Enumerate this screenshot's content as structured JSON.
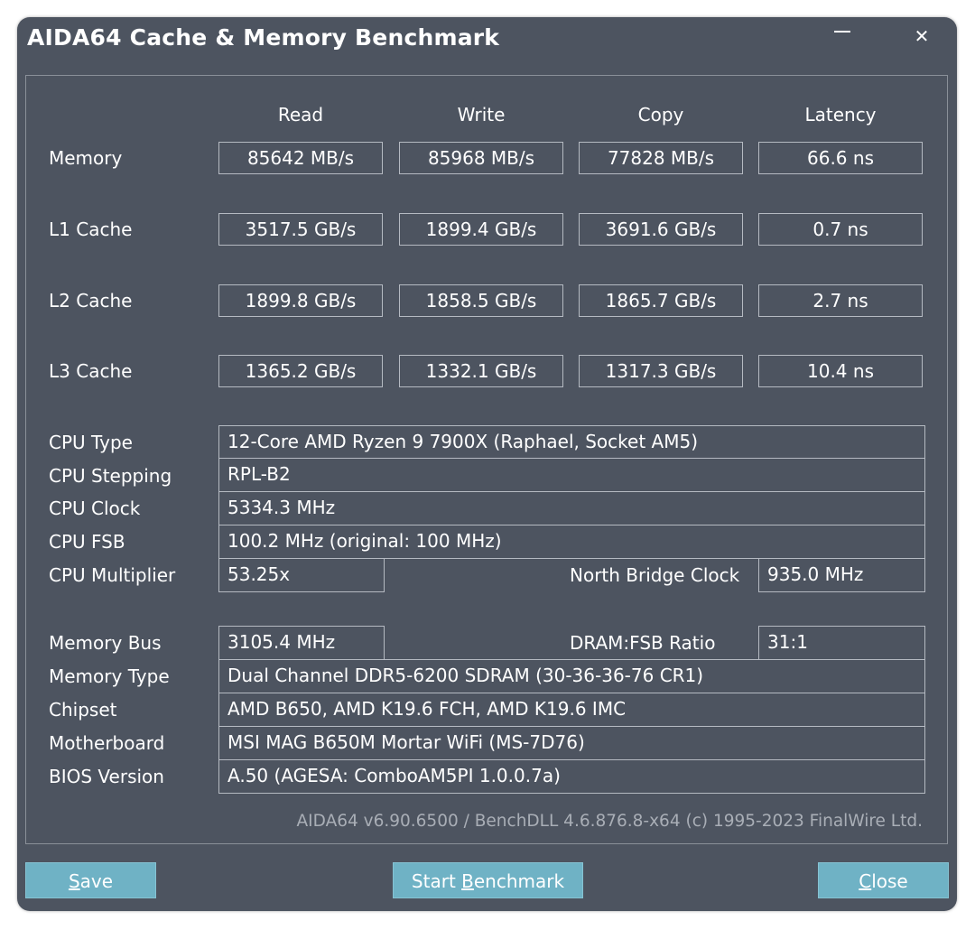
{
  "window": {
    "title": "AIDA64 Cache & Memory Benchmark",
    "close_glyph": "✕"
  },
  "columns": [
    "Read",
    "Write",
    "Copy",
    "Latency"
  ],
  "rows": [
    {
      "label": "Memory",
      "values": [
        "85642 MB/s",
        "85968 MB/s",
        "77828 MB/s",
        "66.6 ns"
      ]
    },
    {
      "label": "L1 Cache",
      "values": [
        "3517.5 GB/s",
        "1899.4 GB/s",
        "3691.6 GB/s",
        "0.7 ns"
      ]
    },
    {
      "label": "L2 Cache",
      "values": [
        "1899.8 GB/s",
        "1858.5 GB/s",
        "1865.7 GB/s",
        "2.7 ns"
      ]
    },
    {
      "label": "L3 Cache",
      "values": [
        "1365.2 GB/s",
        "1332.1 GB/s",
        "1317.3 GB/s",
        "10.4 ns"
      ]
    }
  ],
  "cpu": {
    "type_label": "CPU Type",
    "type_value": "12-Core AMD Ryzen 9 7900X  (Raphael, Socket AM5)",
    "stepping_label": "CPU Stepping",
    "stepping_value": "RPL-B2",
    "clock_label": "CPU Clock",
    "clock_value": "5334.3 MHz",
    "fsb_label": "CPU FSB",
    "fsb_value": "100.2 MHz  (original: 100 MHz)",
    "multiplier_label": "CPU Multiplier",
    "multiplier_value": "53.25x",
    "nb_clock_label": "North Bridge Clock",
    "nb_clock_value": "935.0 MHz"
  },
  "memory": {
    "bus_label": "Memory Bus",
    "bus_value": "3105.4 MHz",
    "ratio_label": "DRAM:FSB Ratio",
    "ratio_value": "31:1",
    "type_label": "Memory Type",
    "type_value": "Dual Channel DDR5-6200 SDRAM  (30-36-36-76 CR1)",
    "chipset_label": "Chipset",
    "chipset_value": "AMD B650, AMD K19.6 FCH, AMD K19.6 IMC",
    "motherboard_label": "Motherboard",
    "motherboard_value": "MSI MAG B650M Mortar WiFi (MS-7D76)",
    "bios_label": "BIOS Version",
    "bios_value": "A.50  (AGESA: ComboAM5PI 1.0.0.7a)"
  },
  "footer": "AIDA64 v6.90.6500 / BenchDLL 4.6.876.8-x64  (c) 1995-2023 FinalWire Ltd.",
  "buttons": {
    "save_first": "S",
    "save_rest": "ave",
    "start_pre": "Start ",
    "start_u": "B",
    "start_rest": "enchmark",
    "close_first": "C",
    "close_rest": "lose"
  },
  "colors": {
    "window_bg": "#4d5460",
    "button_bg": "#6fb2c5"
  }
}
